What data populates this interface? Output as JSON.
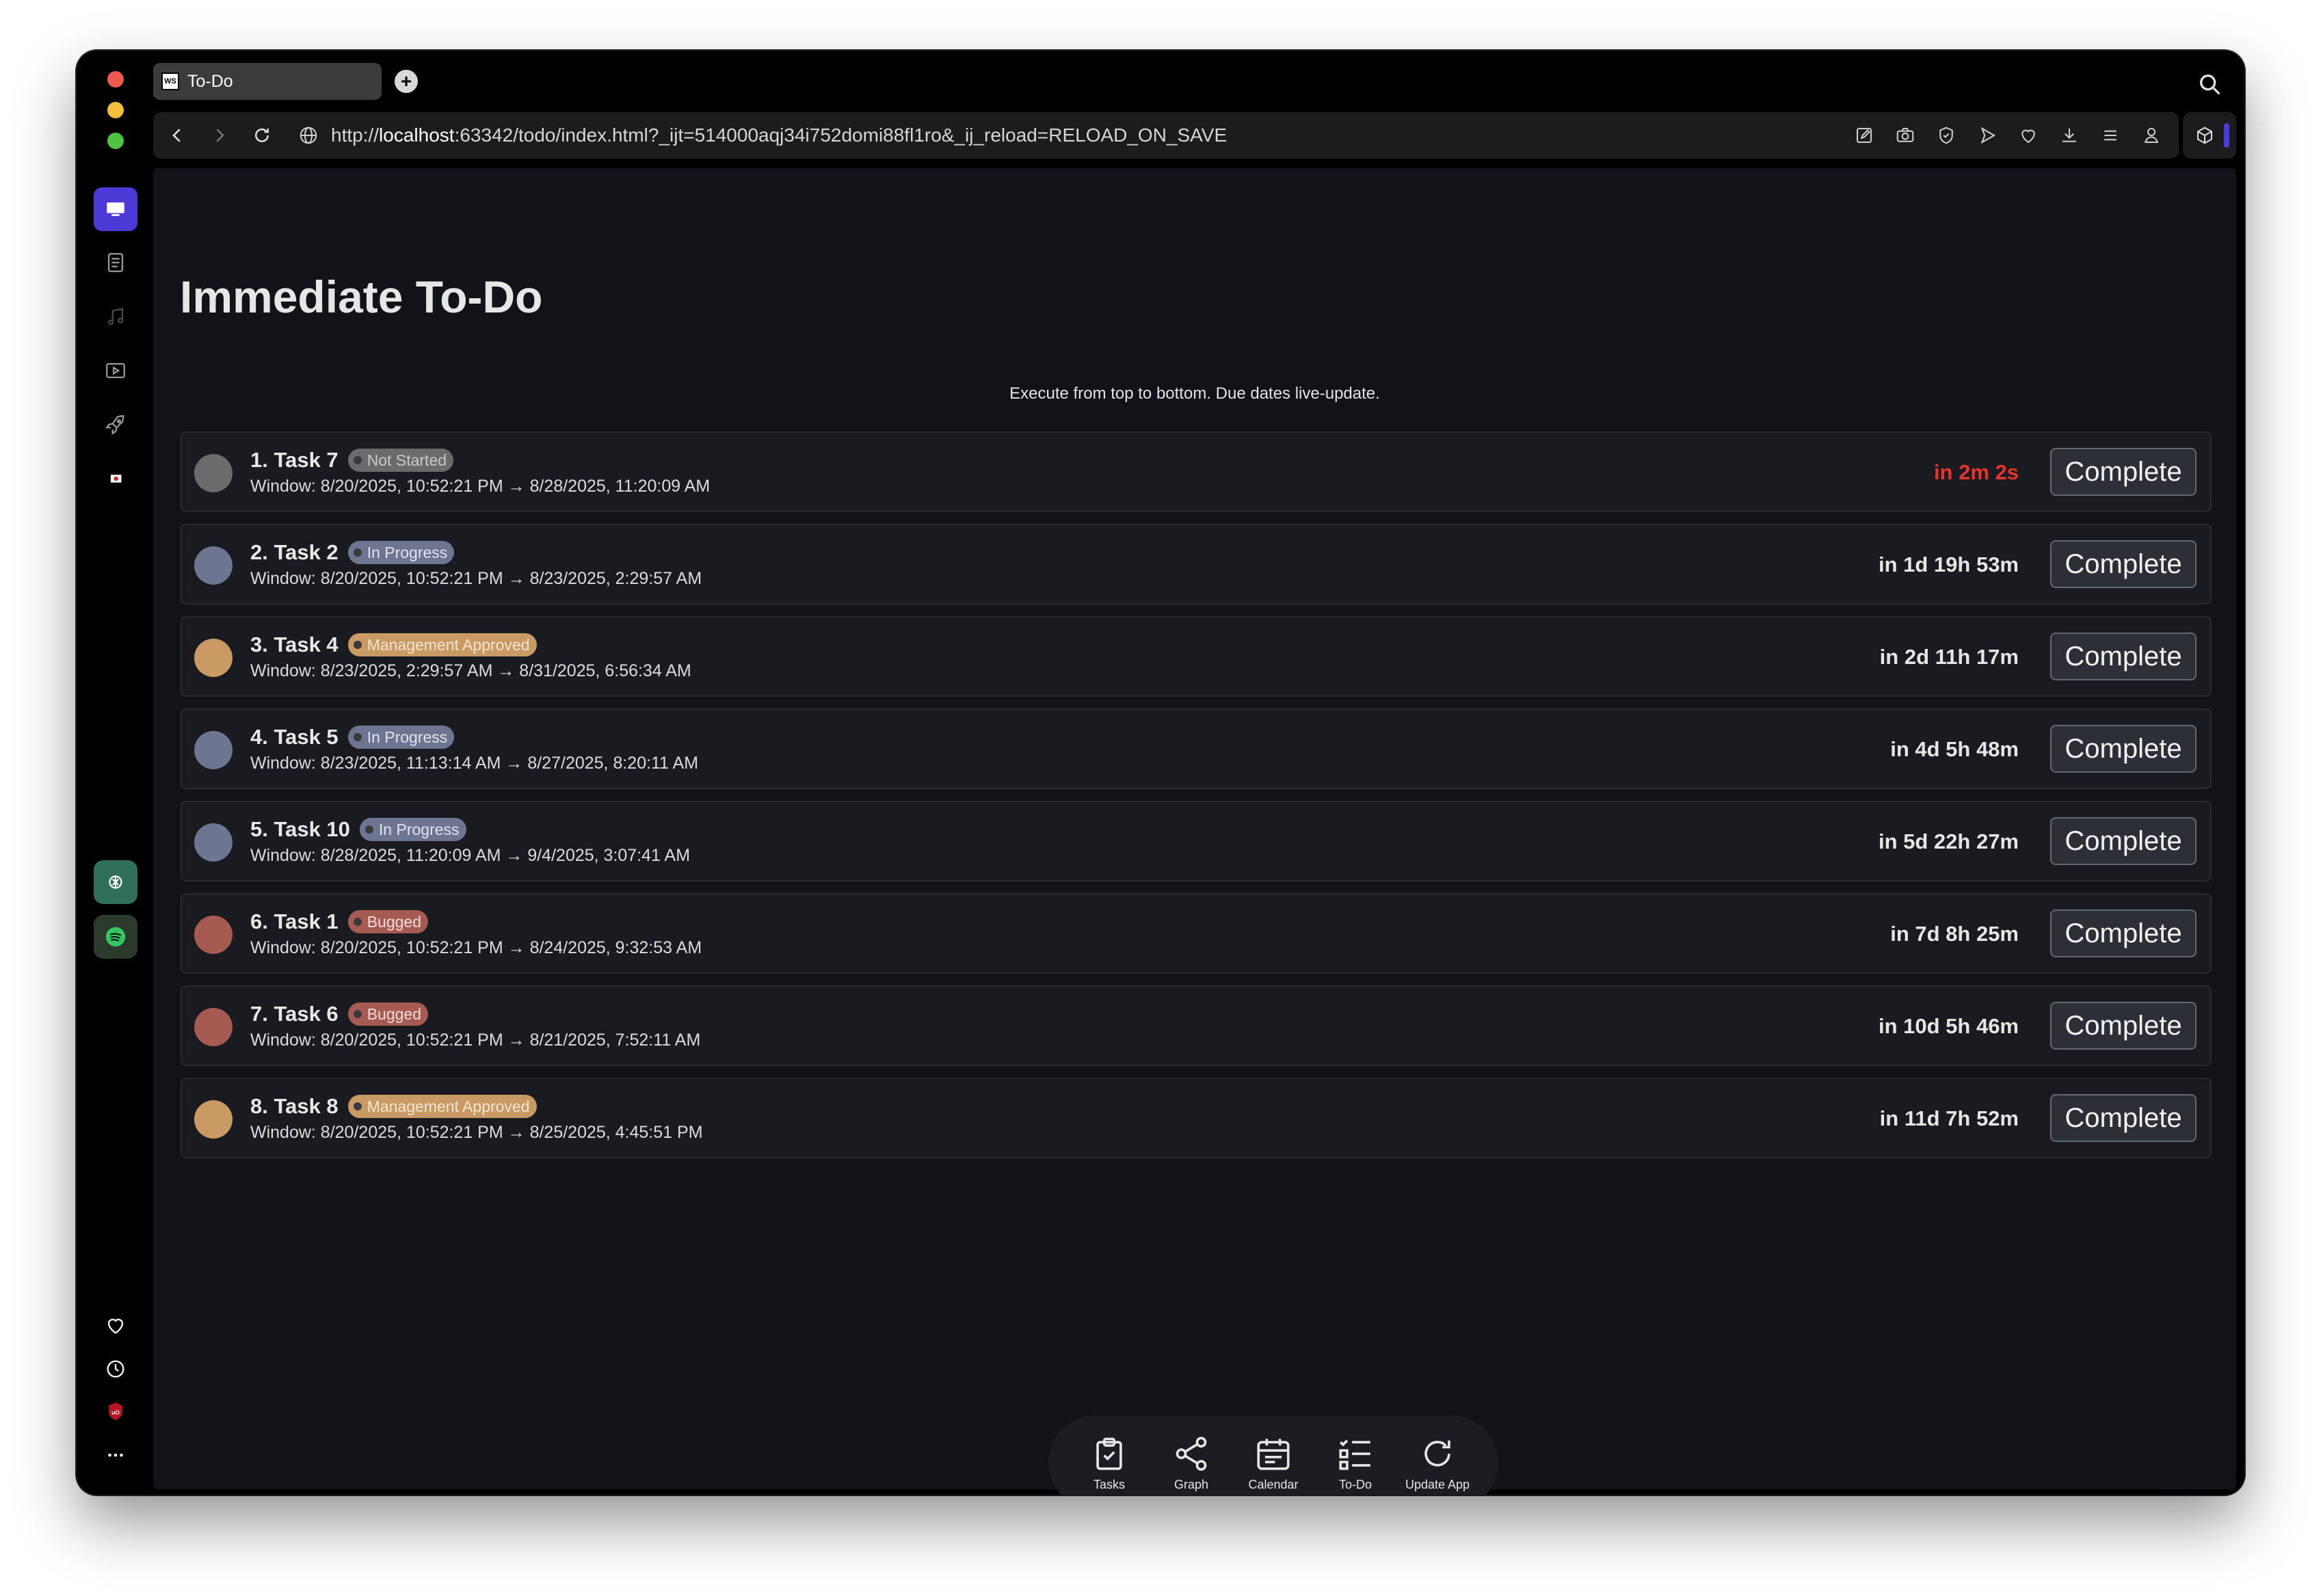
{
  "browser": {
    "tab_title": "To-Do",
    "tab_logo": "WS",
    "url_prefix": "http://",
    "url_host": "localhost",
    "url_rest": ":63342/todo/index.html?_ijt=514000aqj34i752domi88fl1ro&_ij_reload=RELOAD_ON_SAVE",
    "colors": {
      "accent": "#4b3ad6",
      "background": "#111318"
    }
  },
  "page": {
    "title": "Immediate To-Do",
    "subtitle": "Execute from top to bottom. Due dates live-update."
  },
  "tasks": [
    {
      "name": "1. Task 7",
      "status": "Not Started",
      "status_color": "#6b6b6e",
      "dot_color": "#6b6b6e",
      "window": "Window: 8/20/2025, 10:52:21 PM → 8/28/2025, 11:20:09 AM",
      "due": "in 2m 2s",
      "urgent": true,
      "button": "Complete"
    },
    {
      "name": "2. Task 2",
      "status": "In Progress",
      "status_color": "#6e7590",
      "dot_color": "#6e7590",
      "window": "Window: 8/20/2025, 10:52:21 PM → 8/23/2025, 2:29:57 AM",
      "due": "in 1d 19h 53m",
      "urgent": false,
      "button": "Complete"
    },
    {
      "name": "3. Task 4",
      "status": "Management Approved",
      "status_color": "#c99a63",
      "dot_color": "#c99a63",
      "window": "Window: 8/23/2025, 2:29:57 AM → 8/31/2025, 6:56:34 AM",
      "due": "in 2d 11h 17m",
      "urgent": false,
      "button": "Complete"
    },
    {
      "name": "4. Task 5",
      "status": "In Progress",
      "status_color": "#6e7590",
      "dot_color": "#6e7590",
      "window": "Window: 8/23/2025, 11:13:14 AM → 8/27/2025, 8:20:11 AM",
      "due": "in 4d 5h 48m",
      "urgent": false,
      "button": "Complete"
    },
    {
      "name": "5. Task 10",
      "status": "In Progress",
      "status_color": "#6e7590",
      "dot_color": "#6e7590",
      "window": "Window: 8/28/2025, 11:20:09 AM → 9/4/2025, 3:07:41 AM",
      "due": "in 5d 22h 27m",
      "urgent": false,
      "button": "Complete"
    },
    {
      "name": "6. Task 1",
      "status": "Bugged",
      "status_color": "#a65b52",
      "dot_color": "#a65b52",
      "window": "Window: 8/20/2025, 10:52:21 PM → 8/24/2025, 9:32:53 AM",
      "due": "in 7d 8h 25m",
      "urgent": false,
      "button": "Complete"
    },
    {
      "name": "7. Task 6",
      "status": "Bugged",
      "status_color": "#a65b52",
      "dot_color": "#a65b52",
      "window": "Window: 8/20/2025, 10:52:21 PM → 8/21/2025, 7:52:11 AM",
      "due": "in 10d 5h 46m",
      "urgent": false,
      "button": "Complete"
    },
    {
      "name": "8. Task 8",
      "status": "Management Approved",
      "status_color": "#c99a63",
      "dot_color": "#c99a63",
      "window": "Window: 8/20/2025, 10:52:21 PM → 8/25/2025, 4:45:51 PM",
      "due": "in 11d 7h 52m",
      "urgent": false,
      "button": "Complete"
    }
  ],
  "bottom_nav": [
    {
      "label": "Tasks",
      "icon": "clipboard-check-icon"
    },
    {
      "label": "Graph",
      "icon": "share-graph-icon"
    },
    {
      "label": "Calendar",
      "icon": "calendar-icon"
    },
    {
      "label": "To-Do",
      "icon": "checklist-icon"
    },
    {
      "label": "Update App",
      "icon": "refresh-icon"
    }
  ]
}
